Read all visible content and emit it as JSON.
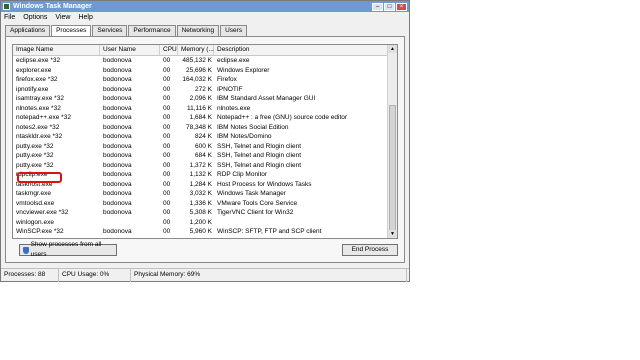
{
  "window": {
    "title": "Windows Task Manager"
  },
  "menu": [
    "File",
    "Options",
    "View",
    "Help"
  ],
  "tabs": [
    "Applications",
    "Processes",
    "Services",
    "Performance",
    "Networking",
    "Users"
  ],
  "columns": [
    "Image Name",
    "User Name",
    "CPU",
    "Memory (...",
    "Description"
  ],
  "rows": [
    {
      "name": "eclipse.exe *32",
      "user": "bodonova",
      "cpu": "00",
      "mem": "485,132 K",
      "desc": "eclipse.exe"
    },
    {
      "name": "explorer.exe",
      "user": "bodonova",
      "cpu": "00",
      "mem": "25,696 K",
      "desc": "Windows Explorer"
    },
    {
      "name": "firefox.exe *32",
      "user": "bodonova",
      "cpu": "00",
      "mem": "164,032 K",
      "desc": "Firefox"
    },
    {
      "name": "ipnotify.exe",
      "user": "bodonova",
      "cpu": "00",
      "mem": "272 K",
      "desc": "IPNOTIF"
    },
    {
      "name": "isamtray.exe *32",
      "user": "bodonova",
      "cpu": "00",
      "mem": "2,096 K",
      "desc": "IBM Standard Asset Manager GUI"
    },
    {
      "name": "nlnotes.exe *32",
      "user": "bodonova",
      "cpu": "00",
      "mem": "11,116 K",
      "desc": "nlnotes.exe"
    },
    {
      "name": "notepad++.exe *32",
      "user": "bodonova",
      "cpu": "00",
      "mem": "1,684 K",
      "desc": "Notepad++ : a free (GNU) source code editor"
    },
    {
      "name": "notes2.exe *32",
      "user": "bodonova",
      "cpu": "00",
      "mem": "78,348 K",
      "desc": "IBM Notes Social Edition"
    },
    {
      "name": "ntaskldr.exe *32",
      "user": "bodonova",
      "cpu": "00",
      "mem": "824 K",
      "desc": "IBM Notes/Domino"
    },
    {
      "name": "putty.exe *32",
      "user": "bodonova",
      "cpu": "00",
      "mem": "600 K",
      "desc": "SSH, Telnet and Rlogin client"
    },
    {
      "name": "putty.exe *32",
      "user": "bodonova",
      "cpu": "00",
      "mem": "684 K",
      "desc": "SSH, Telnet and Rlogin client"
    },
    {
      "name": "putty.exe *32",
      "user": "bodonova",
      "cpu": "00",
      "mem": "1,372 K",
      "desc": "SSH, Telnet and Rlogin client"
    },
    {
      "name": "rdpclip.exe",
      "user": "bodonova",
      "cpu": "00",
      "mem": "1,132 K",
      "desc": "RDP Clip Monitor"
    },
    {
      "name": "taskhost.exe",
      "user": "bodonova",
      "cpu": "00",
      "mem": "1,284 K",
      "desc": "Host Process for Windows Tasks"
    },
    {
      "name": "taskmgr.exe",
      "user": "bodonova",
      "cpu": "00",
      "mem": "3,032 K",
      "desc": "Windows Task Manager"
    },
    {
      "name": "vmtoolsd.exe",
      "user": "bodonova",
      "cpu": "00",
      "mem": "1,336 K",
      "desc": "VMware Tools Core Service"
    },
    {
      "name": "vncviewer.exe *32",
      "user": "bodonova",
      "cpu": "00",
      "mem": "5,308 K",
      "desc": "TigerVNC Client for Win32"
    },
    {
      "name": "winlogon.exe",
      "user": "",
      "cpu": "00",
      "mem": "1,200 K",
      "desc": ""
    },
    {
      "name": "WinSCP.exe *32",
      "user": "bodonova",
      "cpu": "00",
      "mem": "5,960 K",
      "desc": "WinSCP: SFTP, FTP and SCP client"
    }
  ],
  "buttons": {
    "show_all": "Show processes from all users",
    "end": "End Process"
  },
  "status": {
    "processes": "Processes: 88",
    "cpu": "CPU Usage: 0%",
    "memory": "Physical Memory: 69%"
  },
  "colors": {
    "title_bar": "#6e9ad1",
    "highlight": "#e01010"
  }
}
